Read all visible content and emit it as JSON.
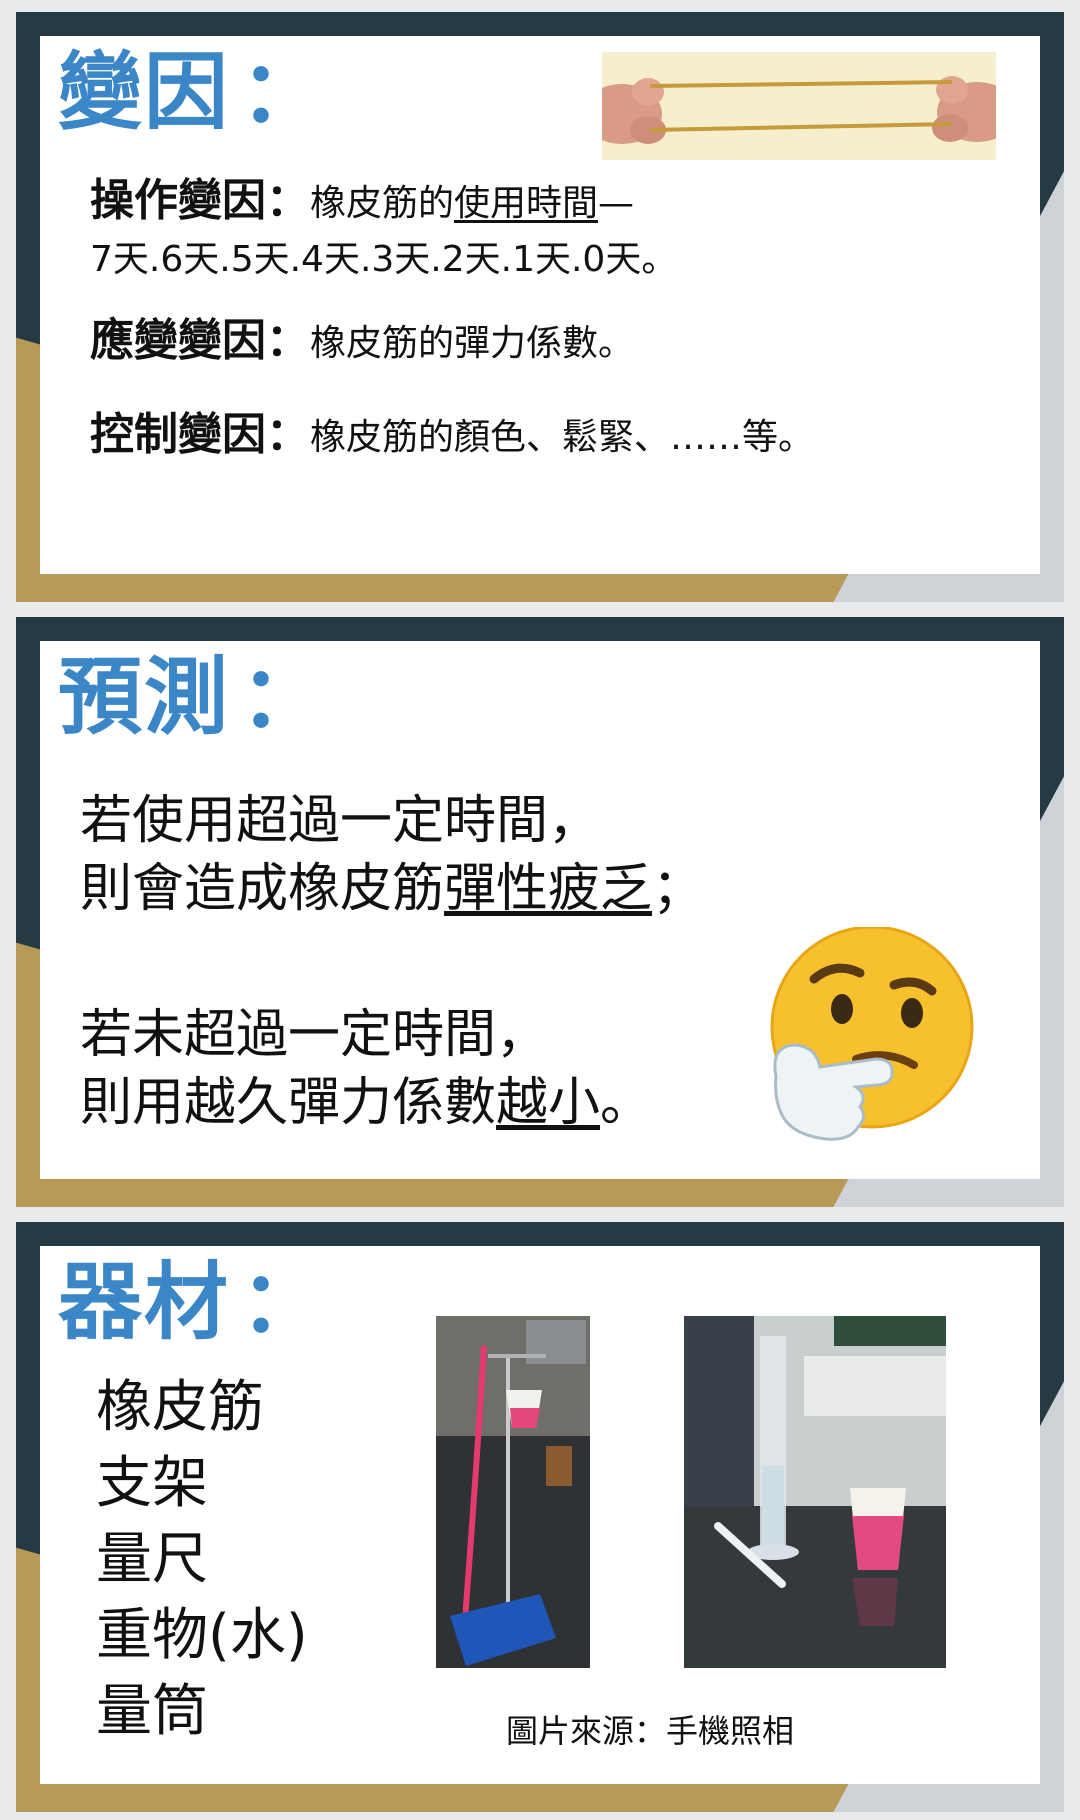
{
  "variables": {
    "heading": "變因",
    "colon": "：",
    "manipulated": {
      "label": "操作變因",
      "colon": "：",
      "text_plain": "橡皮筋的",
      "text_underlined": "使用時間",
      "dash": "—",
      "line2": "7天.6天.5天.4天.3天.2天.1天.0天。"
    },
    "responding": {
      "label": "應變變因",
      "colon": "：",
      "text": "橡皮筋的彈力係數。"
    },
    "controlled": {
      "label": "控制變因",
      "colon": "：",
      "text": "橡皮筋的顏色、鬆緊、……等。"
    }
  },
  "prediction": {
    "heading": "預測",
    "colon": "：",
    "line1": "若使用超過一定時間，",
    "line2_plain": "則會造成橡皮筋",
    "line2_underlined": "彈性疲乏",
    "line2_end": "；",
    "line3": "若未超過一定時間，",
    "line4_plain": "則用越久彈力係數",
    "line4_underlined": "越小",
    "line4_end": "。"
  },
  "materials": {
    "heading": "器材",
    "colon": "：",
    "items": [
      "橡皮筋",
      "支架",
      "量尺",
      "重物(水)",
      "量筒"
    ],
    "caption": "圖片來源：手機照相"
  }
}
